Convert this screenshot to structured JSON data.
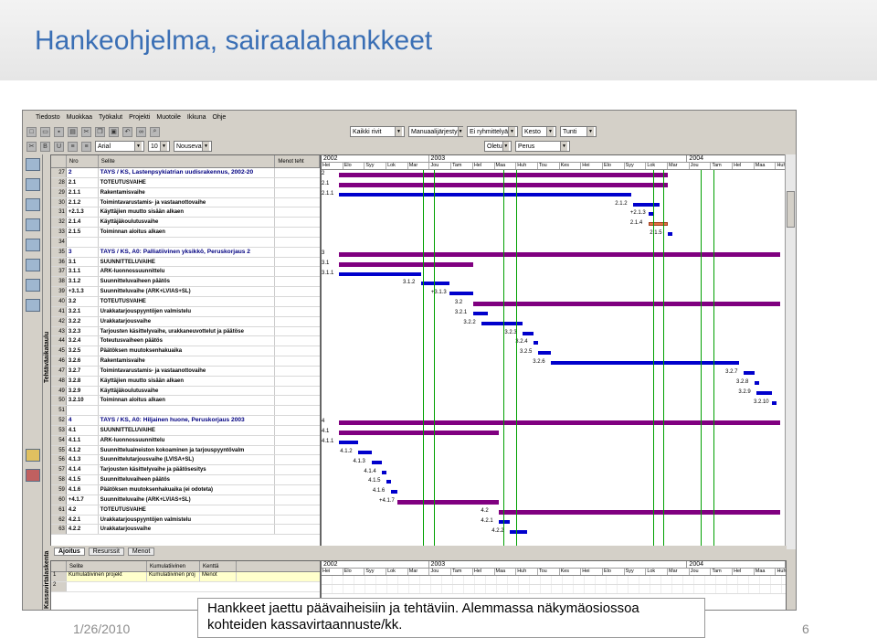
{
  "slide": {
    "title": "Hankeohjelma, sairaalahankkeet",
    "caption_line1": "Hankkeet jaettu päävaiheisiin ja tehtäviin. Alemmassa näkymäosiossoa",
    "caption_line2": "kohteiden kassavirtaannuste/kk.",
    "date": "1/26/2010",
    "page": "6"
  },
  "app": {
    "menu": [
      "Tiedosto",
      "Muokkaa",
      "Työkalut",
      "Projekti",
      "Muotoile",
      "Ikkuna",
      "Ohje"
    ],
    "toolbar1": {
      "filter": "Kaikki rivit",
      "sort": "Manuaalijärjesty",
      "group": "Ei ryhmittelyä",
      "duration": "Kesto",
      "unit": "Tunti"
    },
    "toolbar2": {
      "font": "Arial",
      "size": "10",
      "order": "Nouseva",
      "view": "Oletu",
      "base": "Perus"
    },
    "side_label_top": "Tehtäväaikataulu",
    "side_label_bottom": "Kassavirtalaskenta",
    "grid_headers": {
      "nro": "Nro",
      "selite": "Selite",
      "menot": "Menot teht"
    },
    "rows": [
      {
        "idx": "27",
        "nro": "2",
        "selite": "TAYS / KS, Lastenpsykiatrian uudisrakennus, 2002-20",
        "lvl": "0"
      },
      {
        "idx": "28",
        "nro": "2.1",
        "selite": "TOTEUTUSVAIHE",
        "lvl": "1"
      },
      {
        "idx": "29",
        "nro": "2.1.1",
        "selite": "Rakentamisvaihe",
        "lvl": "1"
      },
      {
        "idx": "30",
        "nro": "2.1.2",
        "selite": "Toimintavarustamis- ja vastaanottovaihe",
        "lvl": "1"
      },
      {
        "idx": "31",
        "nro": "+2.1.3",
        "selite": "Käyttäjien muutto sisään alkaen",
        "lvl": "1"
      },
      {
        "idx": "32",
        "nro": "2.1.4",
        "selite": "Käyttäjäkoulutusvaihe",
        "lvl": "1"
      },
      {
        "idx": "33",
        "nro": "2.1.5",
        "selite": "Toiminnan aloitus alkaen",
        "lvl": "1"
      },
      {
        "idx": "34",
        "nro": "",
        "selite": "",
        "lvl": "1"
      },
      {
        "idx": "35",
        "nro": "3",
        "selite": "TAYS / KS, A0: Palliatiivinen yksikkö, Peruskorjaus 2",
        "lvl": "0"
      },
      {
        "idx": "36",
        "nro": "3.1",
        "selite": "SUUNNITTELUVAIHE",
        "lvl": "1"
      },
      {
        "idx": "37",
        "nro": "3.1.1",
        "selite": "ARK-luonnossuunnittelu",
        "lvl": "1"
      },
      {
        "idx": "38",
        "nro": "3.1.2",
        "selite": "Suunnitteluvaiheen päätös",
        "lvl": "1"
      },
      {
        "idx": "39",
        "nro": "+3.1.3",
        "selite": "Suunnitteluvaihe (ARK+LVIAS+SL)",
        "lvl": "1"
      },
      {
        "idx": "40",
        "nro": "3.2",
        "selite": "TOTEUTUSVAIHE",
        "lvl": "1"
      },
      {
        "idx": "41",
        "nro": "3.2.1",
        "selite": "Urakkatarjouspyyntöjen valmistelu",
        "lvl": "1"
      },
      {
        "idx": "42",
        "nro": "3.2.2",
        "selite": "Urakkatarjousvaihe",
        "lvl": "1"
      },
      {
        "idx": "43",
        "nro": "3.2.3",
        "selite": "Tarjousten käsittelyvaihe, urakkaneuvottelut ja päätöse",
        "lvl": "1"
      },
      {
        "idx": "44",
        "nro": "3.2.4",
        "selite": "Toteutusvaiheen päätös",
        "lvl": "1"
      },
      {
        "idx": "45",
        "nro": "3.2.5",
        "selite": "Päätöksen muutoksenhakuaika",
        "lvl": "1"
      },
      {
        "idx": "46",
        "nro": "3.2.6",
        "selite": "Rakentamisvaihe",
        "lvl": "1"
      },
      {
        "idx": "47",
        "nro": "3.2.7",
        "selite": "Toimintavarustamis- ja vastaanottovaihe",
        "lvl": "1"
      },
      {
        "idx": "48",
        "nro": "3.2.8",
        "selite": "Käyttäjien muutto sisään alkaen",
        "lvl": "1"
      },
      {
        "idx": "49",
        "nro": "3.2.9",
        "selite": "Käyttäjäkoulutusvaihe",
        "lvl": "1"
      },
      {
        "idx": "50",
        "nro": "3.2.10",
        "selite": "Toiminnan aloitus alkaen",
        "lvl": "1"
      },
      {
        "idx": "51",
        "nro": "",
        "selite": "",
        "lvl": "1"
      },
      {
        "idx": "52",
        "nro": "4",
        "selite": "TAYS / KS, A0: Hiljainen huone, Peruskorjaus 2003",
        "lvl": "0"
      },
      {
        "idx": "53",
        "nro": "4.1",
        "selite": "SUUNNITTELUVAIHE",
        "lvl": "1"
      },
      {
        "idx": "54",
        "nro": "4.1.1",
        "selite": "ARK-luonnossuunnittelu",
        "lvl": "1"
      },
      {
        "idx": "55",
        "nro": "4.1.2",
        "selite": "Suunnittelualneiston kokoaminen ja tarjouspyyntövalm",
        "lvl": "1"
      },
      {
        "idx": "56",
        "nro": "4.1.3",
        "selite": "Suunnittelutarjousvaihe (LVISA+SL)",
        "lvl": "1"
      },
      {
        "idx": "57",
        "nro": "4.1.4",
        "selite": "Tarjousten käsittelyvaihe ja päätösesitys",
        "lvl": "1"
      },
      {
        "idx": "58",
        "nro": "4.1.5",
        "selite": "Suunnitteluvaiheen päätös",
        "lvl": "1"
      },
      {
        "idx": "59",
        "nro": "4.1.6",
        "selite": "Päätöksen muutoksenhakuaika (ei odoteta)",
        "lvl": "1"
      },
      {
        "idx": "60",
        "nro": "+4.1.7",
        "selite": "Suunnitteluvaihe (ARK+LVIAS+SL)",
        "lvl": "1"
      },
      {
        "idx": "61",
        "nro": "4.2",
        "selite": "TOTEUTUSVAIHE",
        "lvl": "1"
      },
      {
        "idx": "62",
        "nro": "4.2.1",
        "selite": "Urakkatarjouspyyntöjen valmistelu",
        "lvl": "1"
      },
      {
        "idx": "63",
        "nro": "4.2.2",
        "selite": "Urakkatarjousvaihe",
        "lvl": "1"
      }
    ],
    "tabs": [
      "Ajoitus",
      "Resurssit",
      "Menot"
    ],
    "gantt_years": [
      "2002",
      "2003",
      "2004"
    ],
    "gantt_months": [
      "Hei",
      "Elo",
      "Syy",
      "Lok",
      "Mar",
      "Jou",
      "Tam",
      "Hel",
      "Maa",
      "Huh",
      "Tou",
      "Kes",
      "Hei",
      "Elo",
      "Syy",
      "Lok",
      "Mar",
      "Jou",
      "Tam",
      "Hel",
      "Maa",
      "Huh",
      "Tou",
      "Kes",
      "Hei"
    ],
    "lower_headers": {
      "selite": "Selite",
      "kumul": "Kumulatiivinen",
      "kentta": "Kenttä"
    },
    "lower_rows": [
      {
        "idx": "1",
        "selite": "Kumulatiivinen projekt",
        "kumul": "Kumulatiivinen proj",
        "kentta": "Menot"
      },
      {
        "idx": "2",
        "selite": "",
        "kumul": "",
        "kentta": ""
      }
    ],
    "colors": {
      "task_bar": "#0000cc",
      "summary_bar": "#800080",
      "milestone_line": "#00a000"
    }
  }
}
